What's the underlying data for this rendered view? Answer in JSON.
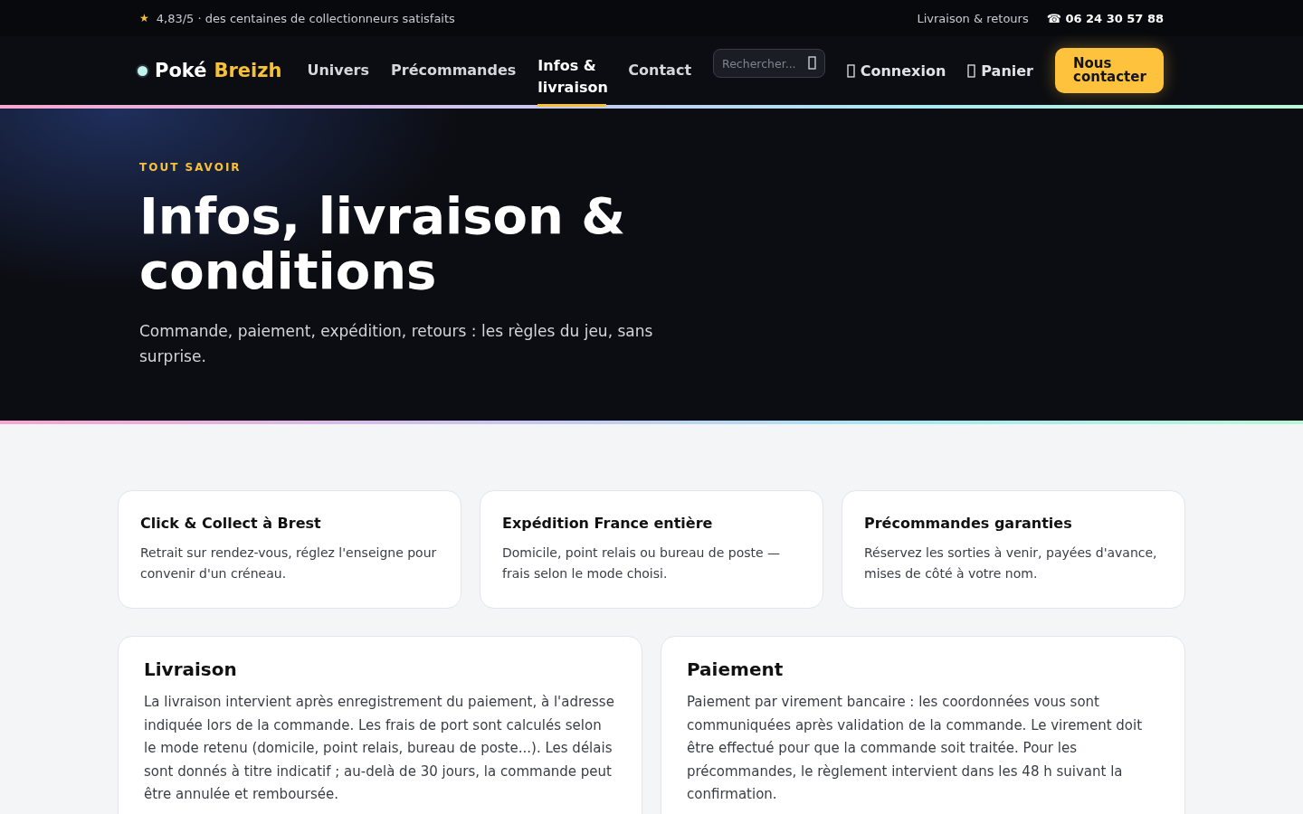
{
  "top_bar": {
    "star": "★",
    "rating": "4,83/5 · des centaines de collectionneurs satisfaits",
    "links": [
      "Livraison & retours"
    ],
    "phone": "☎ 06 24 30 57 88"
  },
  "nav": {
    "logo": {
      "first": "Poké",
      "second": "Breizh"
    },
    "items": [
      {
        "label": "Univers",
        "selected": false
      },
      {
        "label": "Précommandes",
        "selected": false
      },
      {
        "label": "Infos & livraison",
        "selected": true
      },
      {
        "label": "Contact",
        "selected": false
      }
    ],
    "search": {
      "placeholder": "Rechercher..."
    },
    "account": [
      {
        "label": "Connexion"
      },
      {
        "label": "Panier"
      }
    ],
    "cta": "Nous contacter"
  },
  "hero": {
    "eyebrow": "TOUT SAVOIR",
    "title": "Infos, livraison & conditions",
    "subtitle": "Commande, paiement, expédition, retours : les règles du jeu, sans surprise."
  },
  "features": [
    {
      "title": "Click & Collect à Brest",
      "text": "Retrait sur rendez-vous, réglez l'enseigne pour convenir d'un créneau."
    },
    {
      "title": "Expédition France entière",
      "text": "Domicile, point relais ou bureau de poste — frais selon le mode choisi."
    },
    {
      "title": "Précommandes garanties",
      "text": "Réservez les sorties à venir, payées d'avance, mises de côté à votre nom."
    }
  ],
  "sections": [
    {
      "title": "Livraison",
      "text": "La livraison intervient après enregistrement du paiement, à l'adresse indiquée lors de la commande. Les frais de port sont calculés selon le mode retenu (domicile, point relais, bureau de poste...). Les délais sont donnés à titre indicatif ; au-delà de 30 jours, la commande peut être annulée et remboursée."
    },
    {
      "title": "Paiement",
      "text": "Paiement par virement bancaire : les coordonnées vous sont communiquées après validation de la commande. Le virement doit être effectué pour que la commande soit traitée. Pour les précommandes, le règlement intervient dans les 48 h suivant la confirmation."
    }
  ]
}
